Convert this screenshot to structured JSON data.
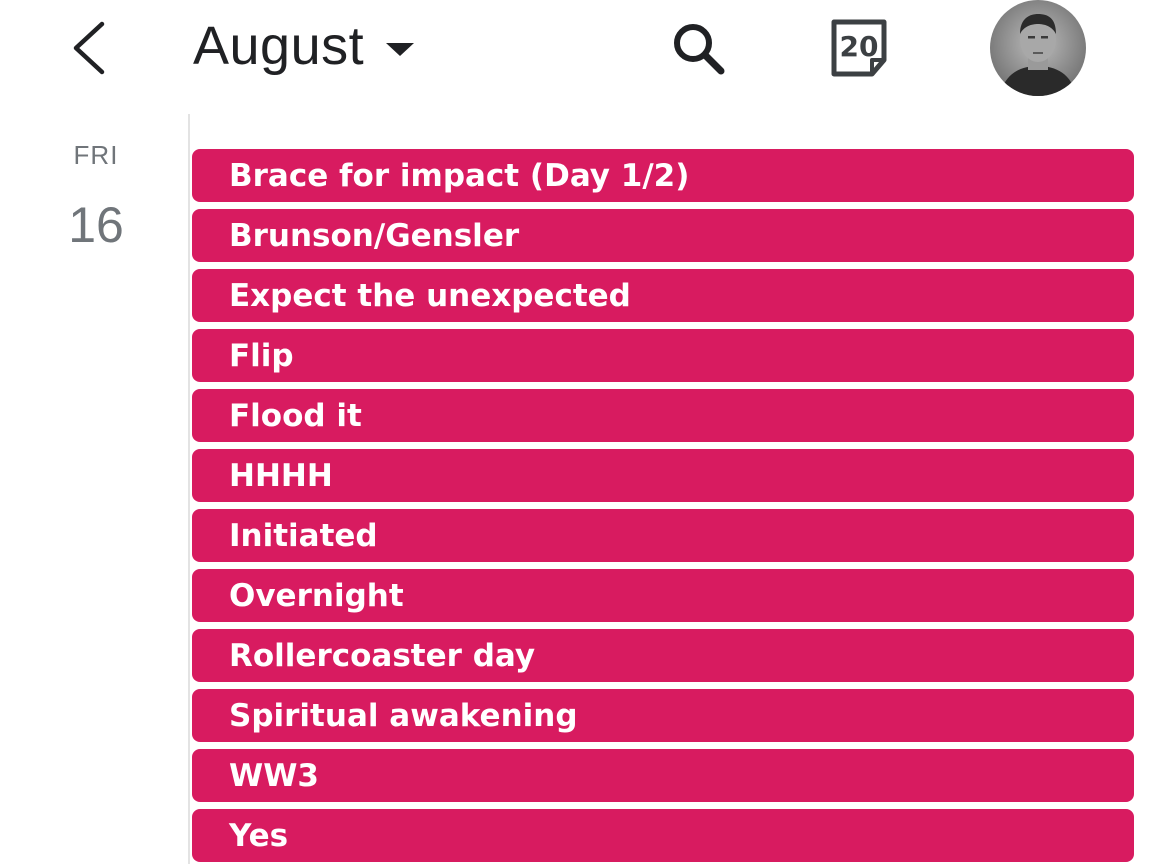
{
  "header": {
    "back_icon": "chevron-left-icon",
    "month": "August",
    "month_dropdown_icon": "caret-down-icon",
    "search_icon": "search-icon",
    "today_icon": "calendar-today-icon",
    "today_date": "20",
    "avatar_icon": "user-avatar"
  },
  "day": {
    "dow": "FRI",
    "date": "16"
  },
  "colors": {
    "event": "#d81b60",
    "text_primary": "#202124",
    "text_secondary": "#70757a"
  },
  "events": [
    {
      "title": "Brace for impact (Day 1/2)"
    },
    {
      "title": "Brunson/Gensler"
    },
    {
      "title": "Expect the unexpected"
    },
    {
      "title": "Flip"
    },
    {
      "title": "Flood it"
    },
    {
      "title": "HHHH"
    },
    {
      "title": "Initiated"
    },
    {
      "title": "Overnight"
    },
    {
      "title": "Rollercoaster day"
    },
    {
      "title": "Spiritual awakening"
    },
    {
      "title": "WW3"
    },
    {
      "title": "Yes"
    }
  ]
}
